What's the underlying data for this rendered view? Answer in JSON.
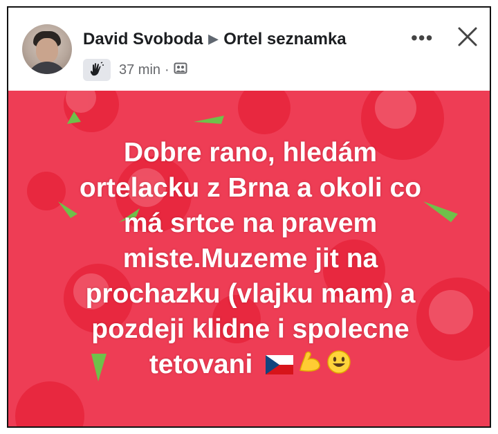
{
  "post": {
    "author": "David Svoboda",
    "group": "Ortel seznamka",
    "time": "37 min",
    "separator": "·",
    "icons": {
      "badge": "wave-hand-icon",
      "audience": "group-audience-icon",
      "more": "more-options-icon",
      "close": "close-icon"
    },
    "text_lines": [
      "Dobre rano, hledám",
      "ortelacku z Brna a okoli co",
      "má srtce na pravem",
      "miste.Muzeme jit na",
      "prochazku (vlajku mam) a",
      "pozdeji klidne i spolecne"
    ],
    "last_line": "tetovani",
    "emojis": [
      "czech-flag-icon",
      "flexed-biceps-icon",
      "smiling-face-icon"
    ],
    "colors": {
      "background": "#ee3d55",
      "rose": "#e8283f",
      "stem": "#6fc04a",
      "text": "#ffffff"
    }
  }
}
